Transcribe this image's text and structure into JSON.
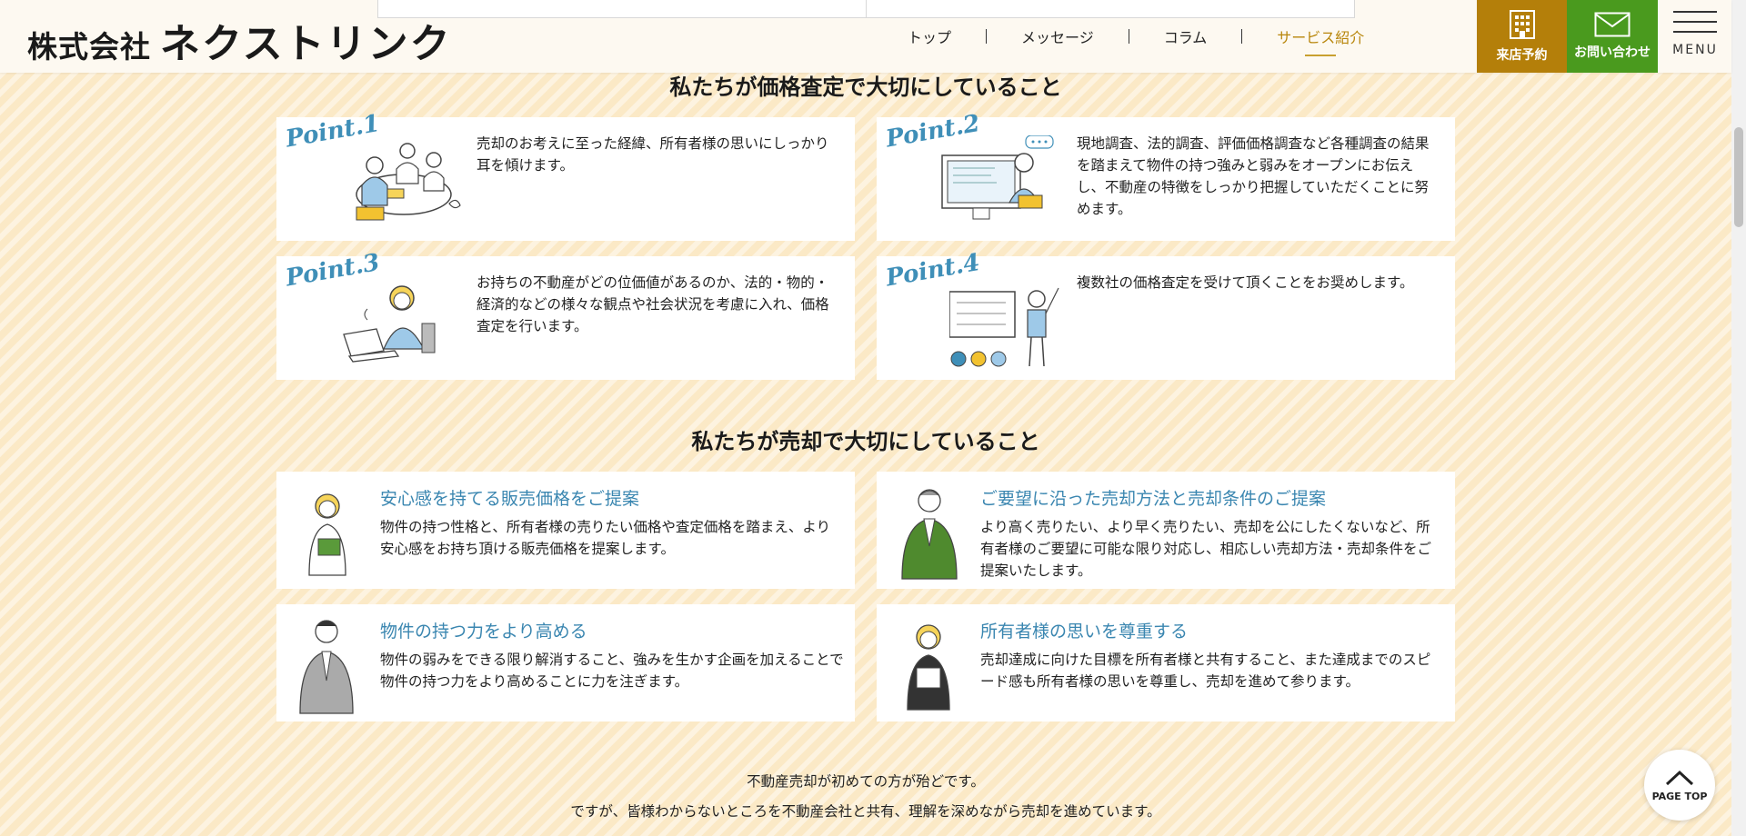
{
  "header": {
    "logo_prefix": "株式会社",
    "logo_name": "ネクストリンク",
    "nav": [
      {
        "label": "トップ"
      },
      {
        "label": "メッセージ"
      },
      {
        "label": "コラム"
      },
      {
        "label": "サービス紹介",
        "active": true
      }
    ],
    "cta_store": "来店予約",
    "cta_contact": "お問い合わせ",
    "menu_label": "MENU"
  },
  "section_appraisal": {
    "title": "私たちが価格査定で大切にしていること",
    "points": [
      {
        "tag": "Point.1",
        "text": "売却のお考えに至った経緯、所有者様の思いにしっかり耳を傾けます。"
      },
      {
        "tag": "Point.2",
        "text": "現地調査、法的調査、評価価格調査など各種調査の結果を踏まえて物件の持つ強みと弱みをオープンにお伝えし、不動産の特徴をしっかり把握していただくことに努めます。"
      },
      {
        "tag": "Point.3",
        "text": "お持ちの不動産がどの位価値があるのか、法的・物的・経済的などの様々な観点や社会状況を考慮に入れ、価格査定を行います。"
      },
      {
        "tag": "Point.4",
        "text": "複数社の価格査定を受けて頂くことをお奨めします。"
      }
    ]
  },
  "section_sale": {
    "title": "私たちが売却で大切にしていること",
    "items": [
      {
        "heading": "安心感を持てる販売価格をご提案",
        "text": "物件の持つ性格と、所有者様の売りたい価格や査定価格を踏まえ、より安心感をお持ち頂ける販売価格を提案します。"
      },
      {
        "heading": "ご要望に沿った売却方法と売却条件のご提案",
        "text": "より高く売りたい、より早く売りたい、売却を公にしたくないなど、所有者様のご要望に可能な限り対応し、相応しい売却方法・売却条件をご提案いたします。"
      },
      {
        "heading": "物件の持つ力をより高める",
        "text": "物件の弱みをできる限り解消すること、強みを生かす企画を加えることで物件の持つ力をより高めることに力を注ぎます。"
      },
      {
        "heading": "所有者様の思いを尊重する",
        "text": "売却達成に向けた目標を所有者様と共有すること、また達成までのスピード感も所有者様の思いを尊重し、売却を進めて参ります。"
      }
    ]
  },
  "bottom": {
    "line1": "不動産売却が初めての方が殆どです。",
    "line2": "ですが、皆様わからないところを不動産会社と共有、理解を深めながら売却を進めています。"
  },
  "page_top_label": "PAGE TOP",
  "colors": {
    "gold": "#b47f0a",
    "green": "#4a9a1e",
    "accent_blue": "#3a86b0",
    "background": "#fbe9c6"
  }
}
